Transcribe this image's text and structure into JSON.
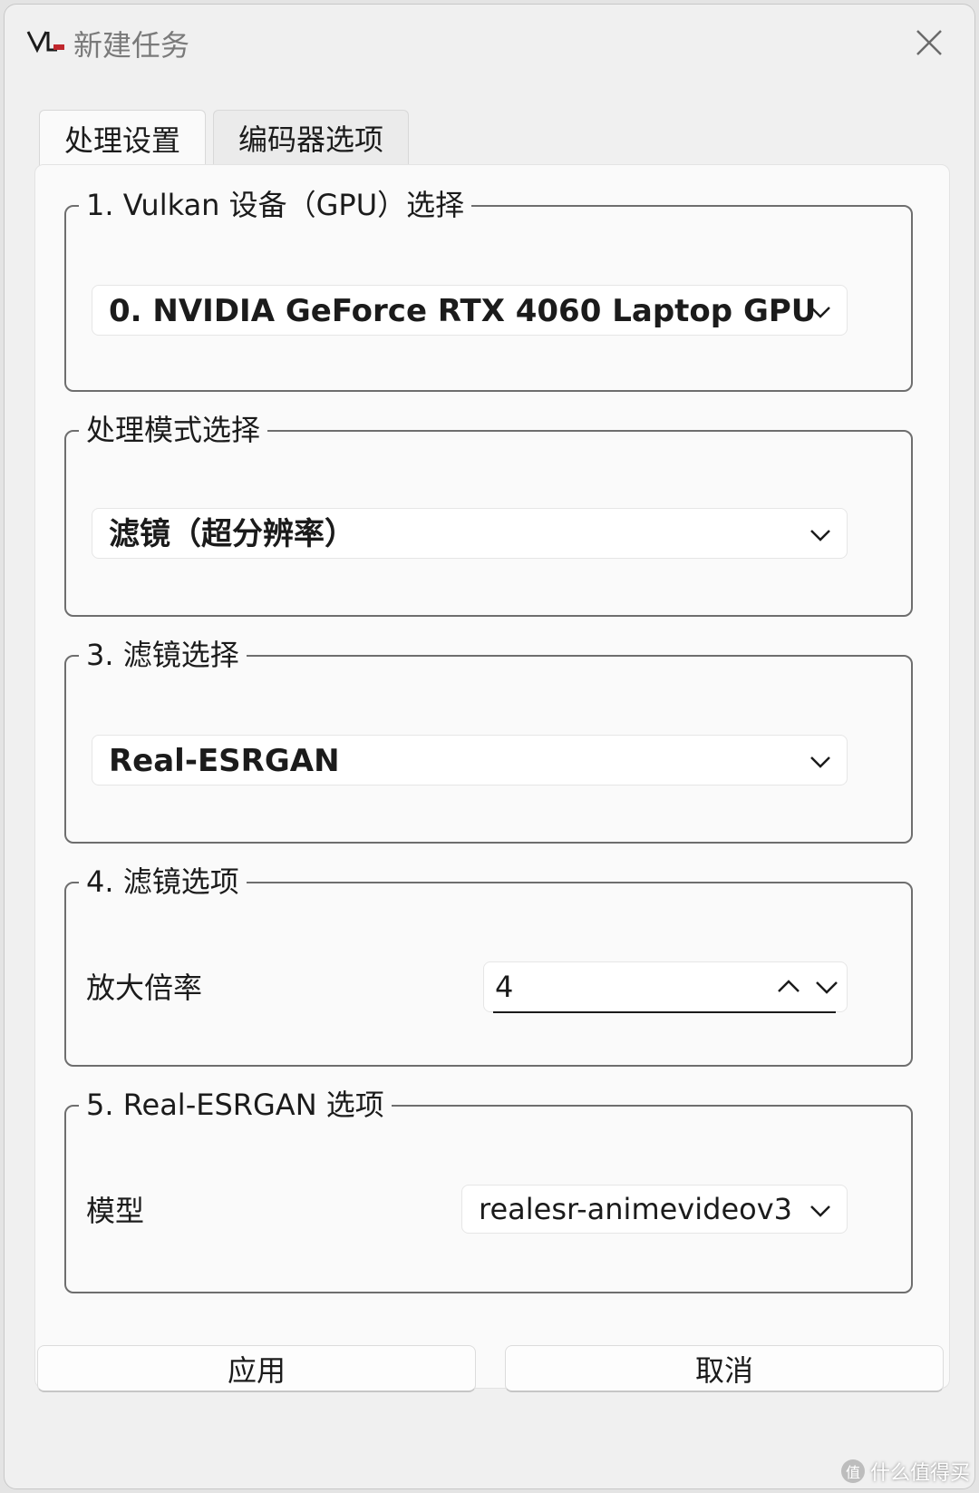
{
  "window": {
    "title": "新建任务",
    "close_icon": "close-icon",
    "logo_icon": "app-logo-icon"
  },
  "tabs": [
    {
      "label": "处理设置",
      "active": true
    },
    {
      "label": "编码器选项",
      "active": false
    }
  ],
  "groups": {
    "gpu": {
      "legend": "1. Vulkan 设备（GPU）选择",
      "selected": "0. NVIDIA GeForce RTX 4060 Laptop GPU"
    },
    "mode": {
      "legend": "处理模式选择",
      "selected": "滤镜（超分辨率）"
    },
    "filter": {
      "legend": "3. 滤镜选择",
      "selected": "Real-ESRGAN"
    },
    "filter_options": {
      "legend": "4. 滤镜选项",
      "scale_label": "放大倍率",
      "scale_value": "4"
    },
    "esrgan_options": {
      "legend": "5. Real-ESRGAN 选项",
      "model_label": "模型",
      "model_value": "realesr-animevideov3"
    }
  },
  "buttons": {
    "apply": "应用",
    "cancel": "取消"
  },
  "watermark": {
    "text": "什么值得买",
    "badge": "值"
  },
  "colors": {
    "window_bg": "#f0f0f0",
    "panel_bg": "#fafafa",
    "group_border": "#6e6e6e",
    "logo_red": "#c0272d"
  }
}
